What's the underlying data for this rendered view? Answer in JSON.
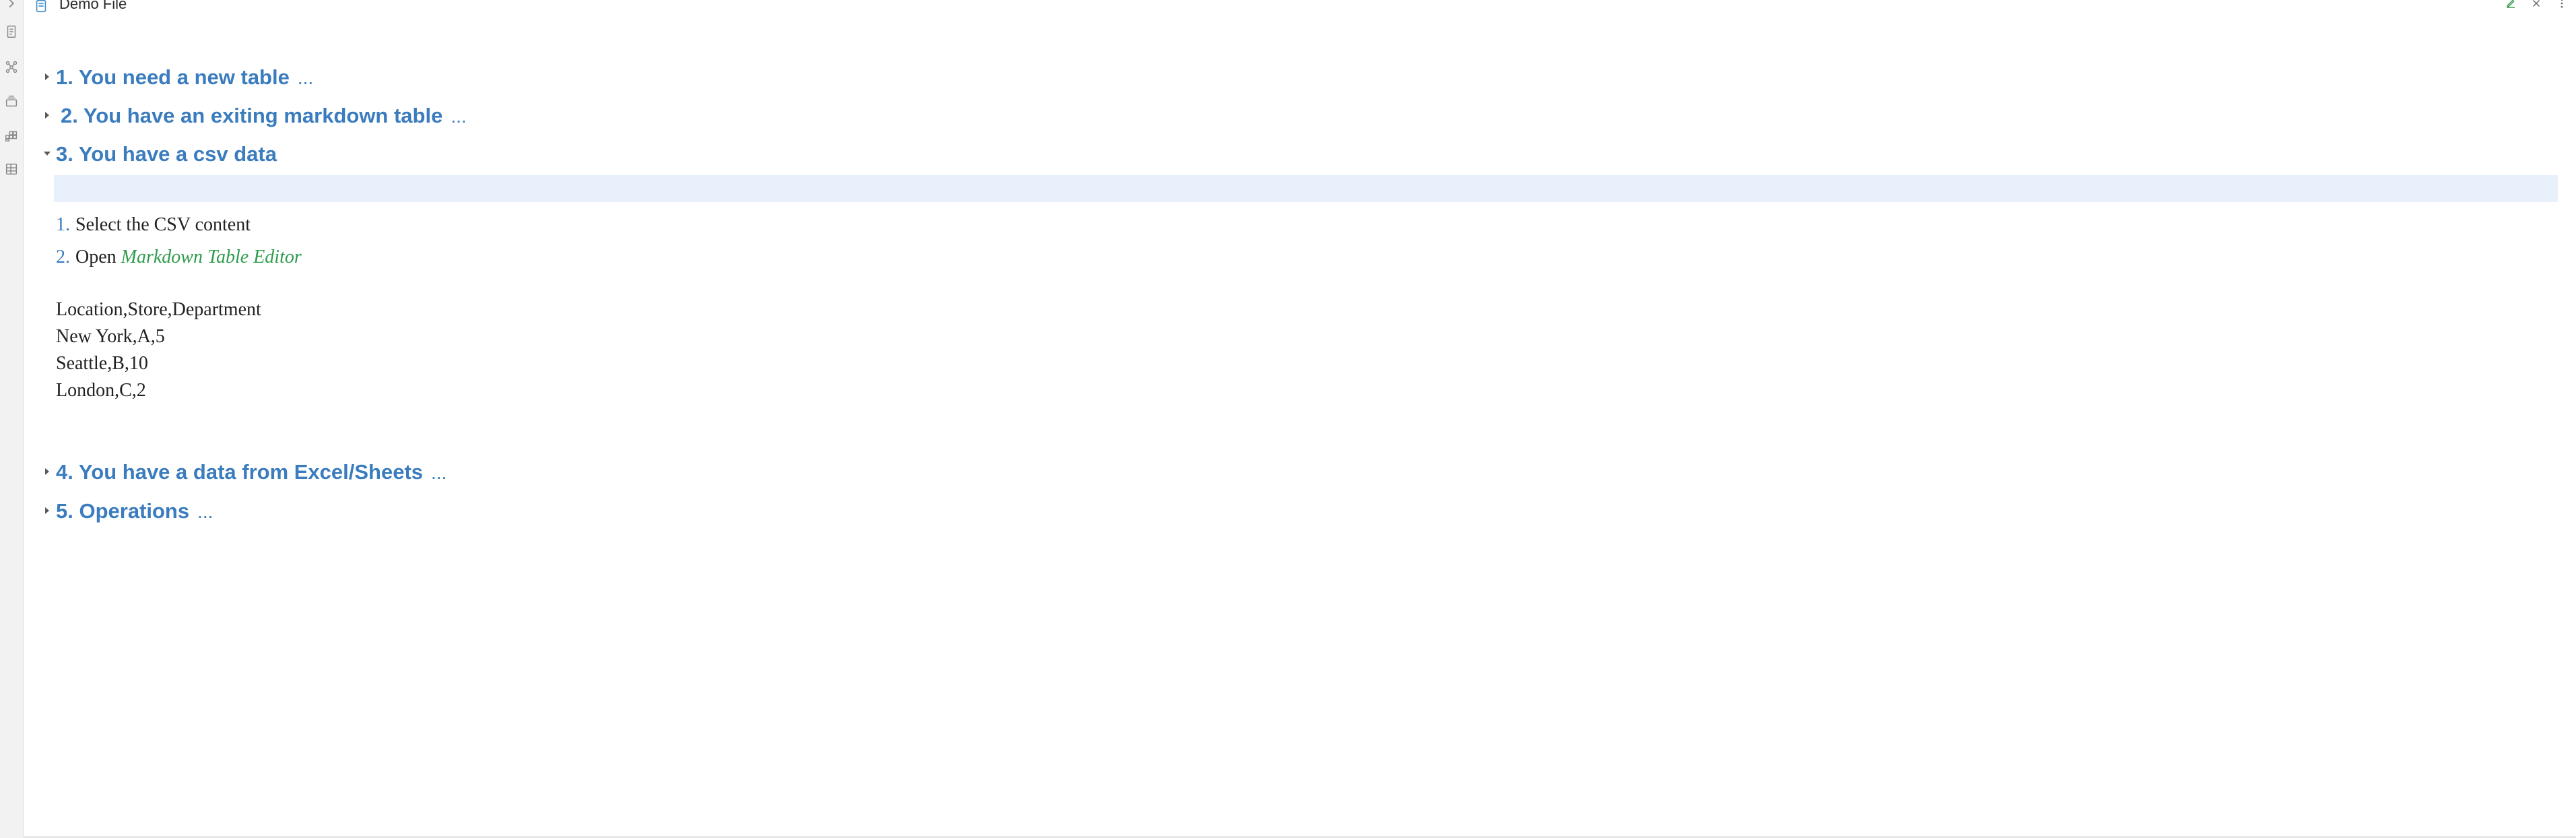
{
  "window": {
    "title": "Demo File"
  },
  "ribbon": {
    "icons": [
      "chevron-right-icon",
      "document-icon",
      "graph-icon",
      "layers-icon",
      "grid-icon",
      "table-icon"
    ]
  },
  "header": {
    "actions": [
      "edit-icon",
      "close-icon",
      "more-icon"
    ]
  },
  "headings": [
    {
      "label": "1. You need a new table",
      "collapsed": true,
      "ellipsis": "..."
    },
    {
      "label": "2. You have an exiting markdown table",
      "collapsed": true,
      "ellipsis": "..."
    },
    {
      "label": "3. You have a csv data",
      "collapsed": false,
      "ellipsis": ""
    },
    {
      "label": "4. You have a data from Excel/Sheets",
      "collapsed": true,
      "ellipsis": "..."
    },
    {
      "label": "5. Operations",
      "collapsed": true,
      "ellipsis": "..."
    }
  ],
  "section3": {
    "steps": [
      {
        "num": "1.",
        "text": "Select the CSV content"
      },
      {
        "num": "2.",
        "text": "Open ",
        "emphasis": "Markdown Table Editor"
      }
    ],
    "csv_lines": [
      "Location,Store,Department",
      "New York,A,5",
      "Seattle,B,10",
      "London,C,2"
    ]
  },
  "colors": {
    "heading": "#3a7cbd",
    "emphasis": "#2e9b4d",
    "highlight": "#e8f1fb"
  }
}
